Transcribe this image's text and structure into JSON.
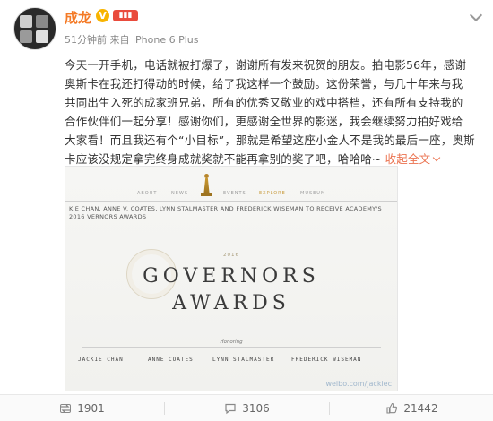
{
  "user": {
    "name": "成龙",
    "verified_badge": "V",
    "meta": "51分钟前 来自 iPhone 6 Plus"
  },
  "post": {
    "lines": [
      "今天一开手机，电话就被打爆了，谢谢所有发来祝贺的朋友。拍电影56年，感谢",
      "奥斯卡在我还打得动的时候，给了我这样一个鼓励。这份荣誉，与几十年来与我",
      "共同出生入死的成家班兄弟，所有的优秀又敬业的戏中搭档，还有所有支持我的",
      "合作伙伴们一起分享！感谢你们，更感谢全世界的影迷，我会继续努力拍好戏给",
      "大家看！而且我还有个“小目标”，那就是希望这座小金人不是我的最后一座，奥斯",
      "卡应该没规定拿完终身成就奖就不能再拿别的奖了吧，哈哈哈~"
    ],
    "expand_label": "收起全文"
  },
  "image": {
    "nav": [
      "ABOUT",
      "NEWS",
      "EVENTS",
      "",
      "EXPLORE",
      "MUSEUM"
    ],
    "headline": "KIE CHAN, ANNE V. COATES, LYNN STALMASTER AND FREDERICK WISEMAN TO RECEIVE ACADEMY'S 2016 VERNORS AWARDS",
    "year": "2016",
    "title_line1": "GOVERNORS",
    "title_line2": "AWARDS",
    "honoring": "Honoring",
    "honorees": [
      "JACKIE CHAN",
      "ANNE COATES",
      "LYNN STALMASTER",
      "FREDERICK WISEMAN"
    ],
    "watermark": "weibo.com/jackiec"
  },
  "actions": {
    "repost_count": "1901",
    "comment_count": "3106",
    "like_count": "21442"
  }
}
